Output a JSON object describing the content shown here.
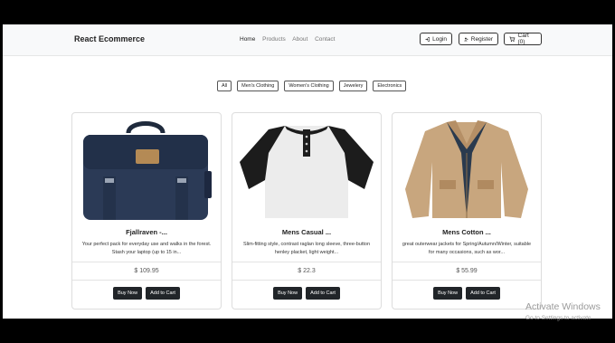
{
  "navbar": {
    "brand": "React Ecommerce",
    "links": [
      "Home",
      "Products",
      "About",
      "Contact"
    ],
    "login_label": "Login",
    "register_label": "Register",
    "cart_label": "Cart (0)"
  },
  "filters": [
    "All",
    "Men's Clothing",
    "Women's Clothing",
    "Jewelery",
    "Electronics"
  ],
  "products": [
    {
      "title": "Fjallraven -...",
      "description": "Your perfect pack for everyday use and walks in the forest. Stash your laptop (up to 15 in...",
      "price": "$ 109.95",
      "image_icon": "backpack-image"
    },
    {
      "title": "Mens Casual ...",
      "description": "Slim-fitting style, contrast raglan long sleeve, three-button henley placket, light weight...",
      "price": "$ 22.3",
      "image_icon": "raglan-shirt-image"
    },
    {
      "title": "Mens Cotton ...",
      "description": "great outerwear jackets for Spring/Autumn/Winter, suitable for many occasions, such as wor...",
      "price": "$ 55.99",
      "image_icon": "jacket-image"
    }
  ],
  "buttons": {
    "buy_now": "Buy Now",
    "add_to_cart": "Add to Cart"
  },
  "watermark": {
    "title": "Activate Windows",
    "subtitle": "Go to Settings to activate"
  }
}
